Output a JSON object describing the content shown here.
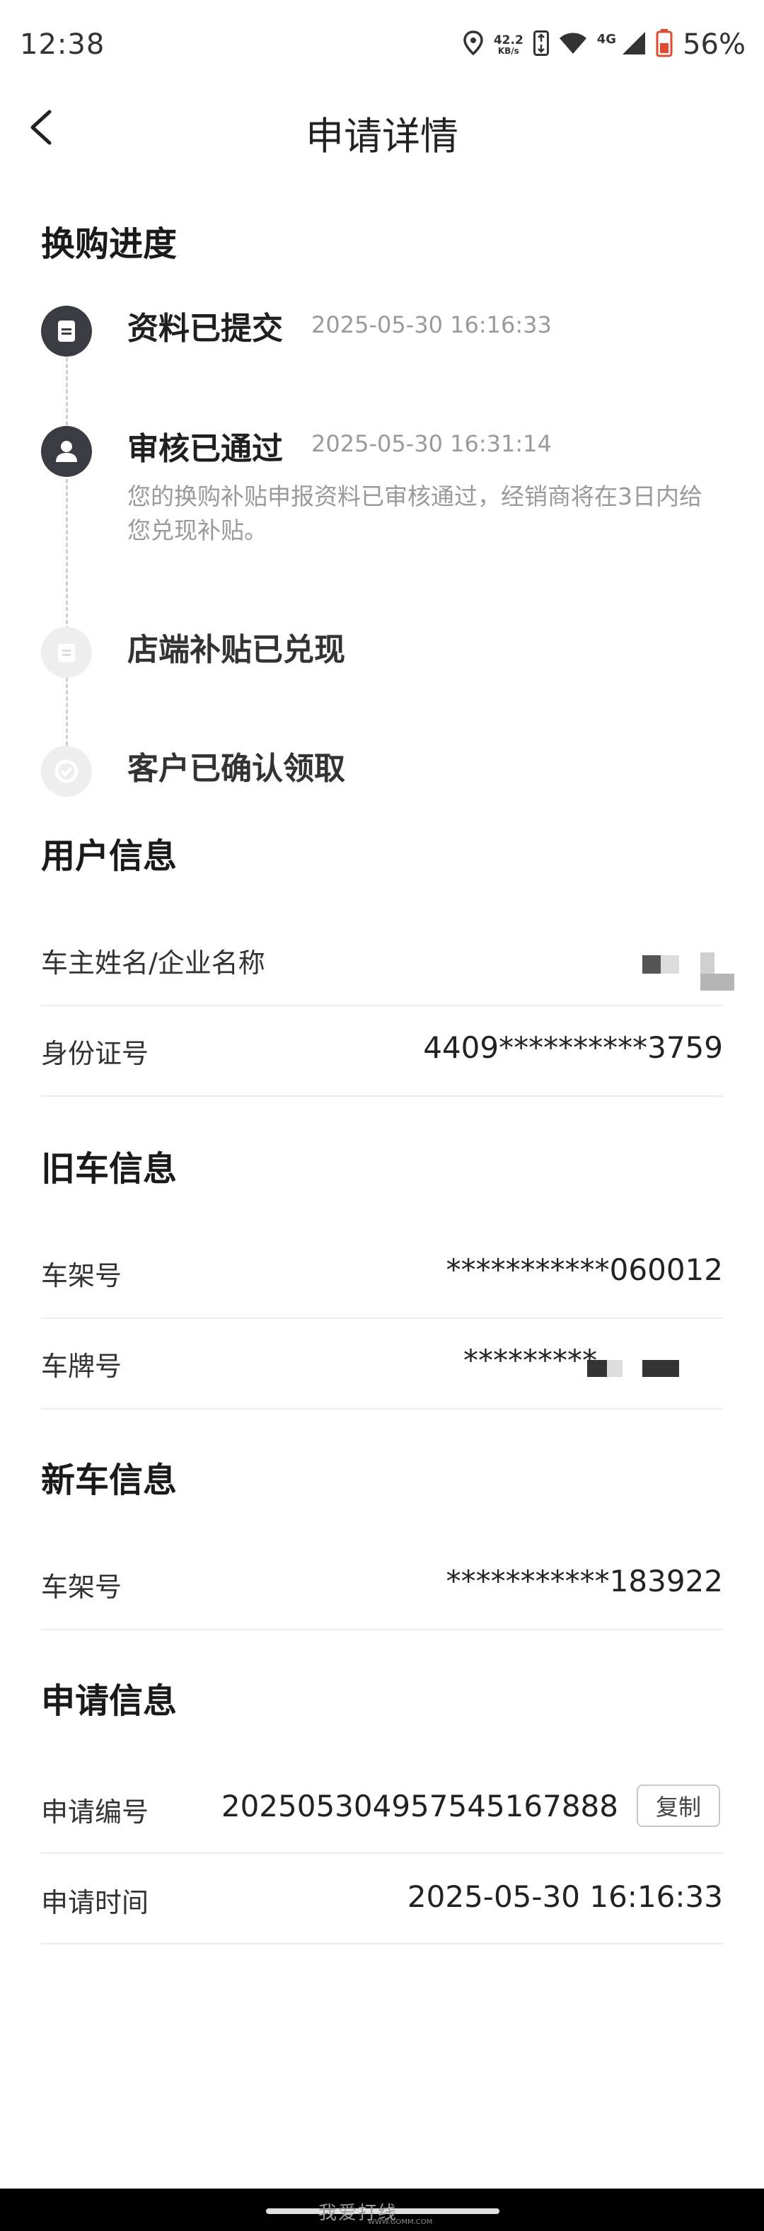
{
  "status_bar": {
    "time": "12:38",
    "speed_value": "42.2",
    "speed_unit": "KB/s",
    "network": "4G",
    "battery": "56%"
  },
  "nav": {
    "title": "申请详情"
  },
  "progress": {
    "title": "换购进度",
    "steps": [
      {
        "label": "资料已提交",
        "time": "2025-05-30 16:16:33",
        "status": "done",
        "icon": "document-icon"
      },
      {
        "label": "审核已通过",
        "time": "2025-05-30 16:31:14",
        "status": "done",
        "icon": "user-icon",
        "desc": "您的换购补贴申报资料已审核通过，经销商将在3日内给您兑现补贴。"
      },
      {
        "label": "店端补贴已兑现",
        "status": "pending",
        "icon": "store-icon"
      },
      {
        "label": "客户已确认领取",
        "status": "pending",
        "icon": "confirm-icon"
      }
    ]
  },
  "user_info": {
    "title": "用户信息",
    "owner_label": "车主姓名/企业名称",
    "id_label": "身份证号",
    "id_value": "4409**********3759"
  },
  "old_car": {
    "title": "旧车信息",
    "vin_label": "车架号",
    "vin_value": "***********060012",
    "plate_label": "车牌号",
    "plate_value": "*********"
  },
  "new_car": {
    "title": "新车信息",
    "vin_label": "车架号",
    "vin_value": "***********183922"
  },
  "application": {
    "title": "申请信息",
    "no_label": "申请编号",
    "no_value": "20250530495754516788​8",
    "copy_label": "复制",
    "time_label": "申请时间",
    "time_value": "2025-05-30 16:16:33"
  },
  "watermark": {
    "text": "我爱打线",
    "sub": "WWW.GOMM.COM"
  },
  "colors": {
    "active_icon": "#3b3b44",
    "inactive_icon": "#eeeeee",
    "muted_text": "#9a9a9a",
    "divider": "#ececec"
  }
}
